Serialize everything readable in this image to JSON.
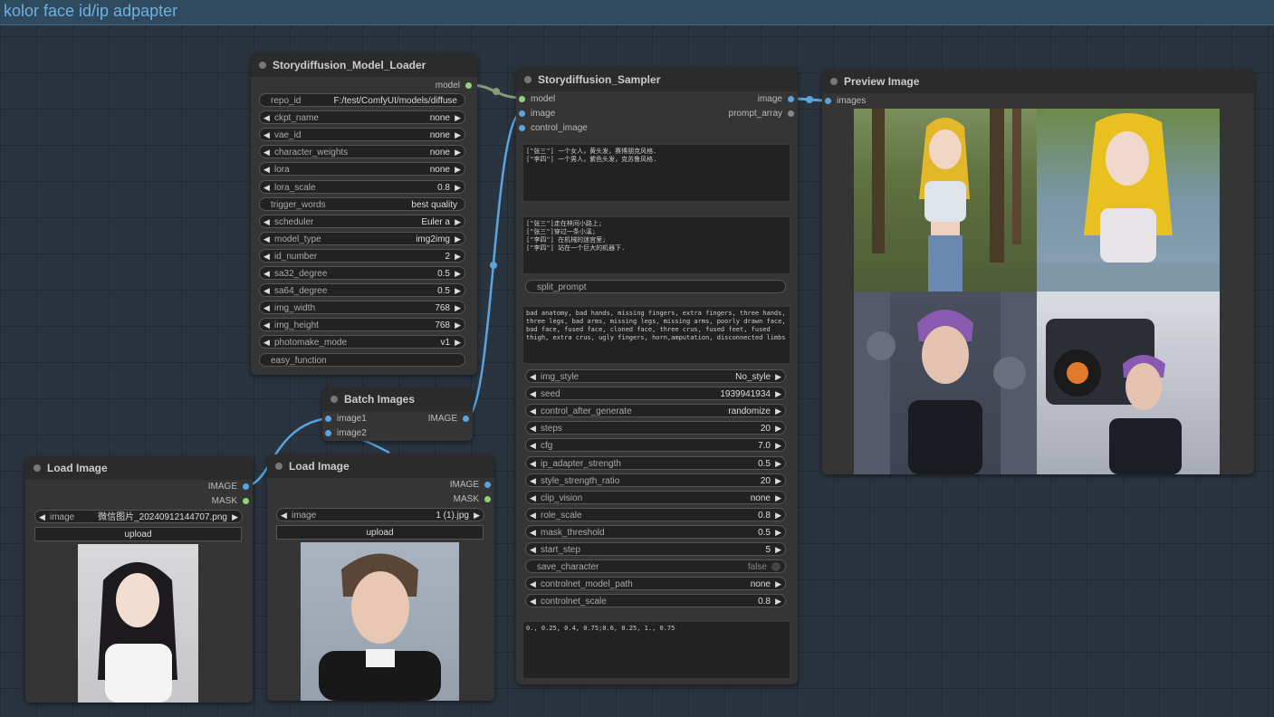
{
  "group": {
    "title": "kolor face id/ip adpapter"
  },
  "model_loader": {
    "title": "Storydiffusion_Model_Loader",
    "output": "model",
    "widgets": [
      {
        "label": "repo_id",
        "value": "F:/test/ComfyUI/models/diffuse"
      },
      {
        "label": "ckpt_name",
        "value": "none"
      },
      {
        "label": "vae_id",
        "value": "none"
      },
      {
        "label": "character_weights",
        "value": "none"
      },
      {
        "label": "lora",
        "value": "none"
      },
      {
        "label": "lora_scale",
        "value": "0.8"
      },
      {
        "label": "trigger_words",
        "value": "best quality"
      },
      {
        "label": "scheduler",
        "value": "Euler a"
      },
      {
        "label": "model_type",
        "value": "img2img"
      },
      {
        "label": "id_number",
        "value": "2"
      },
      {
        "label": "sa32_degree",
        "value": "0.5"
      },
      {
        "label": "sa64_degree",
        "value": "0.5"
      },
      {
        "label": "img_width",
        "value": "768"
      },
      {
        "label": "img_height",
        "value": "768"
      },
      {
        "label": "photomake_mode",
        "value": "v1"
      },
      {
        "label": "easy_function",
        "value": ""
      }
    ]
  },
  "sampler": {
    "title": "Storydiffusion_Sampler",
    "inputs": [
      "model",
      "image",
      "control_image"
    ],
    "outputs": [
      "image",
      "prompt_array"
    ],
    "character_prompt": "[\"张三\"] 一个女人，黄头发，赛博朋克风格.\n[\"李四\"] 一个男人，紫色头发，克苏鲁风格.",
    "scene_prompt": "[\"张三\"]走在林间小路上;\n[\"张三\"]穿过一条小溪;\n[\"李四\"] 在机械的迷宫里;\n[\"李四\"] 站在一个巨大的机器下.",
    "split_prompt": "split_prompt",
    "negative_prompt": "bad anatomy, bad hands, missing fingers, extra fingers, three hands, three legs, bad arms, missing legs, missing arms, poorly drawn face, bad face, fused face, cloned face, three crus, fused feet, fused thigh, extra crus, ugly fingers, horn,amputation, disconnected limbs",
    "widgets": [
      {
        "label": "img_style",
        "value": "No_style"
      },
      {
        "label": "seed",
        "value": "1939941934"
      },
      {
        "label": "control_after_generate",
        "value": "randomize"
      },
      {
        "label": "steps",
        "value": "20"
      },
      {
        "label": "cfg",
        "value": "7.0"
      },
      {
        "label": "ip_adapter_strength",
        "value": "0.5"
      },
      {
        "label": "style_strength_ratio",
        "value": "20"
      },
      {
        "label": "clip_vision",
        "value": "none"
      },
      {
        "label": "role_scale",
        "value": "0.8"
      },
      {
        "label": "mask_threshold",
        "value": "0.5"
      },
      {
        "label": "start_step",
        "value": "5"
      },
      {
        "label": "save_character",
        "value": "false"
      },
      {
        "label": "controlnet_model_path",
        "value": "none"
      },
      {
        "label": "controlnet_scale",
        "value": "0.8"
      }
    ],
    "schedule_text": "0., 0.25, 0.4, 0.75;0.6, 0.25, 1., 0.75"
  },
  "preview": {
    "title": "Preview Image",
    "input": "images"
  },
  "batch": {
    "title": "Batch Images",
    "inputs": [
      "image1",
      "image2"
    ],
    "output": "IMAGE"
  },
  "load1": {
    "title": "Load Image",
    "outputs": [
      "IMAGE",
      "MASK"
    ],
    "image_label": "image",
    "image_value": "微信图片_20240912144707.png",
    "upload": "upload"
  },
  "load2": {
    "title": "Load Image",
    "outputs": [
      "IMAGE",
      "MASK"
    ],
    "image_label": "image",
    "image_value": "1 (1).jpg",
    "upload": "upload"
  },
  "colors": {
    "model_link": "#8fd37a",
    "image_link": "#5aa4e0",
    "group_title": "#6fb1dd"
  }
}
